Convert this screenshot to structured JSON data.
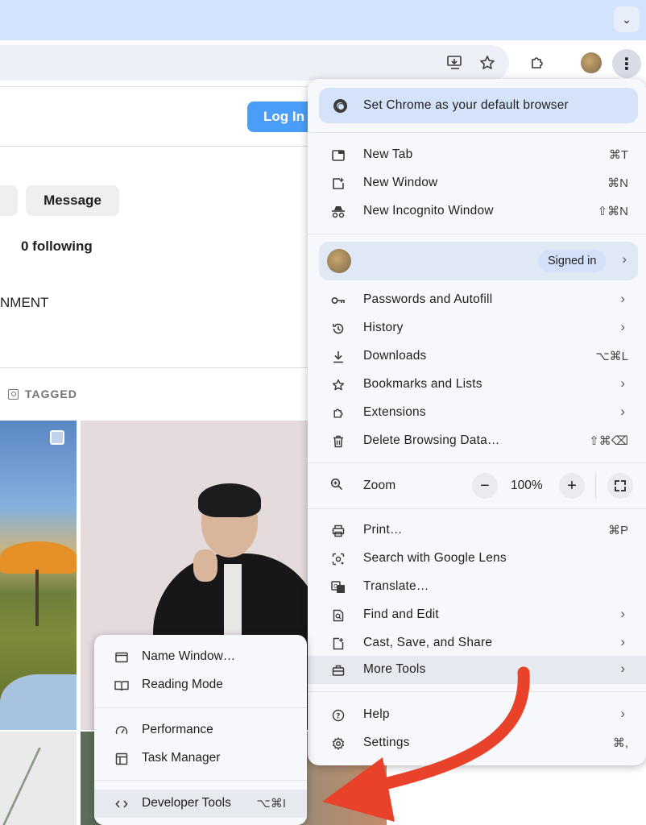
{
  "toolbar": {
    "tab_dropdown_icon": "chevron-down",
    "icons": [
      "install-app-icon",
      "bookmark-star-icon",
      "extensions-icon",
      "profile-avatar",
      "kebab-menu-icon"
    ]
  },
  "page": {
    "login_label": "Log In",
    "message_label": "Message",
    "following_text": "0 following",
    "bio_text": "NMENT",
    "tagged_label": "TAGGED"
  },
  "menu": {
    "default_banner": "Set Chrome as your default browser",
    "group1": [
      {
        "label": "New Tab",
        "shortcut": "⌘T",
        "icon": "new-tab-icon"
      },
      {
        "label": "New Window",
        "shortcut": "⌘N",
        "icon": "new-window-icon"
      },
      {
        "label": "New Incognito Window",
        "shortcut": "⇧⌘N",
        "icon": "incognito-icon"
      }
    ],
    "profile": {
      "badge": "Signed in"
    },
    "group2": [
      {
        "label": "Passwords and Autofill",
        "icon": "key-icon"
      },
      {
        "label": "History",
        "icon": "history-icon"
      },
      {
        "label": "Downloads",
        "shortcut": "⌥⌘L",
        "icon": "download-icon"
      },
      {
        "label": "Bookmarks and Lists",
        "icon": "star-icon"
      },
      {
        "label": "Extensions",
        "icon": "puzzle-icon"
      },
      {
        "label": "Delete Browsing Data…",
        "shortcut": "⇧⌘⌫",
        "icon": "trash-icon"
      }
    ],
    "zoom": {
      "label": "Zoom",
      "value": "100%",
      "minus": "−",
      "plus": "+"
    },
    "group3": [
      {
        "label": "Print…",
        "shortcut": "⌘P",
        "icon": "print-icon"
      },
      {
        "label": "Search with Google Lens",
        "icon": "lens-icon"
      },
      {
        "label": "Translate…",
        "icon": "translate-icon"
      },
      {
        "label": "Find and Edit",
        "icon": "find-icon"
      },
      {
        "label": "Cast, Save, and Share",
        "icon": "cast-icon"
      },
      {
        "label": "More Tools",
        "icon": "toolbox-icon"
      }
    ],
    "group4": [
      {
        "label": "Help",
        "icon": "help-icon"
      },
      {
        "label": "Settings",
        "shortcut": "⌘,",
        "icon": "settings-icon"
      }
    ]
  },
  "submenu": {
    "items": [
      {
        "label": "Name Window…",
        "icon": "window-icon"
      },
      {
        "label": "Reading Mode",
        "icon": "book-icon"
      },
      {
        "label": "Performance",
        "icon": "gauge-icon"
      },
      {
        "label": "Task Manager",
        "icon": "task-manager-icon"
      },
      {
        "label": "Developer Tools",
        "shortcut": "⌥⌘I",
        "icon": "code-icon"
      }
    ]
  },
  "colors": {
    "tabstrip": "#d3e3fd",
    "accent_blue": "#4a9df8",
    "menu_bg": "#f7f8fc",
    "highlight": "#e6e9f0",
    "arrow_red": "#e8432a"
  }
}
